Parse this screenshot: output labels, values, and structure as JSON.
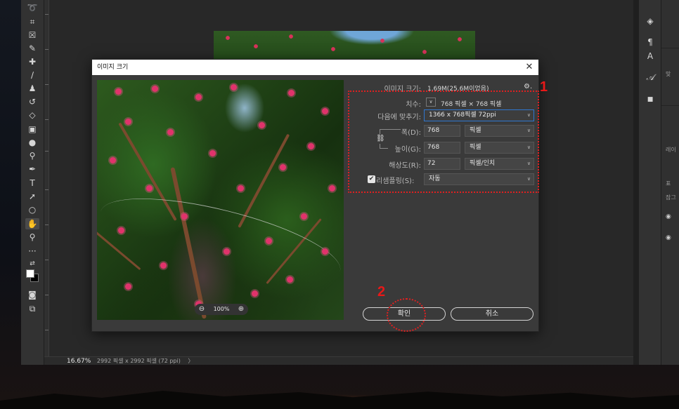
{
  "status_bar": {
    "zoom": "16.67%",
    "doc_info": "2992 픽셀 x 2992 픽셀 (72 ppi)",
    "arrow": "〉"
  },
  "side_panel": {
    "labels": [
      "맞",
      "레이",
      "표",
      "잠그"
    ]
  },
  "dialog": {
    "title": "이미지 크기",
    "close_glyph": "✕",
    "image_size_label": "이미지 크기:",
    "image_size_value": "1.69M(25.6M이었음)",
    "settings_glyph": "⚙.",
    "dimensions_label": "치수:",
    "dimensions_value": "768 픽셀 × 768 픽셀",
    "fit_to_label": "다음에 맞추기:",
    "fit_to_value": "1366 x 768픽셀 72ppi",
    "width_label": "폭(D):",
    "width_value": "768",
    "width_unit": "픽셀",
    "height_label": "높이(G):",
    "height_value": "768",
    "height_unit": "픽셀",
    "resolution_label": "해상도(R):",
    "resolution_value": "72",
    "resolution_unit": "픽셀/인치",
    "resample_label": "리샘플링(S):",
    "resample_value": "자동",
    "resample_checked": true,
    "preview_zoom": "100%",
    "ok_label": "확인",
    "cancel_label": "취소"
  },
  "annotations": {
    "marker1": "1",
    "marker2": "2",
    "color": "#e02020"
  },
  "icons": {
    "tools": [
      "lasso-icon",
      "crop-icon",
      "frame-icon",
      "eyedropper-icon",
      "healing-brush-icon",
      "brush-icon",
      "clone-stamp-icon",
      "history-brush-icon",
      "eraser-icon",
      "gradient-icon",
      "blur-icon",
      "dodge-icon",
      "pen-icon",
      "type-icon",
      "path-selection-icon",
      "ellipse-icon",
      "hand-icon",
      "zoom-icon",
      "more-tools-icon",
      "swap-colors-icon",
      "color-swatches-icon",
      "quick-mask-icon",
      "screen-mode-icon"
    ]
  }
}
